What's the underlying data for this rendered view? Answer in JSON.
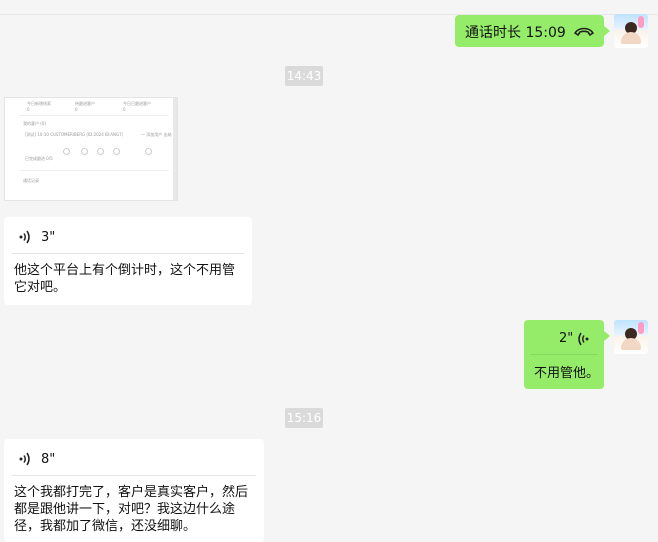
{
  "messages": {
    "call": {
      "label": "通话时长 15:09",
      "icon": "phone-hangup-icon"
    },
    "time1": "14:43",
    "screenshot": {
      "stats": [
        {
          "label": "今日新增线索",
          "value": "0"
        },
        {
          "label": "待跟进客户",
          "value": "0"
        },
        {
          "label": "今日已跟进客户",
          "value": "0"
        }
      ],
      "section1": "我的客户 (0)",
      "row_text": "[测试] 10:10 CUSTOMERIBERG  (ID:2024 IB:ANG7)",
      "row_right": "一 添加用户  出纳",
      "step_label": "已完成跟进 0/5",
      "section2": "通话记录"
    },
    "voice1": {
      "seconds": "3\"",
      "text": "他这个平台上有个倒计时，这个不用管它对吧。"
    },
    "voice_out": {
      "seconds": "2\"",
      "text": "不用管他。"
    },
    "time2": "15:16",
    "voice2": {
      "seconds": "8\"",
      "text": "这个我都打完了，客户是真实客户，然后都是跟他讲一下，对吧？我这边什么途径，我都加了微信，还没细聊。"
    }
  },
  "colors": {
    "bubble_self": "#95ec69",
    "bubble_other": "#ffffff",
    "background": "#f5f5f5"
  }
}
